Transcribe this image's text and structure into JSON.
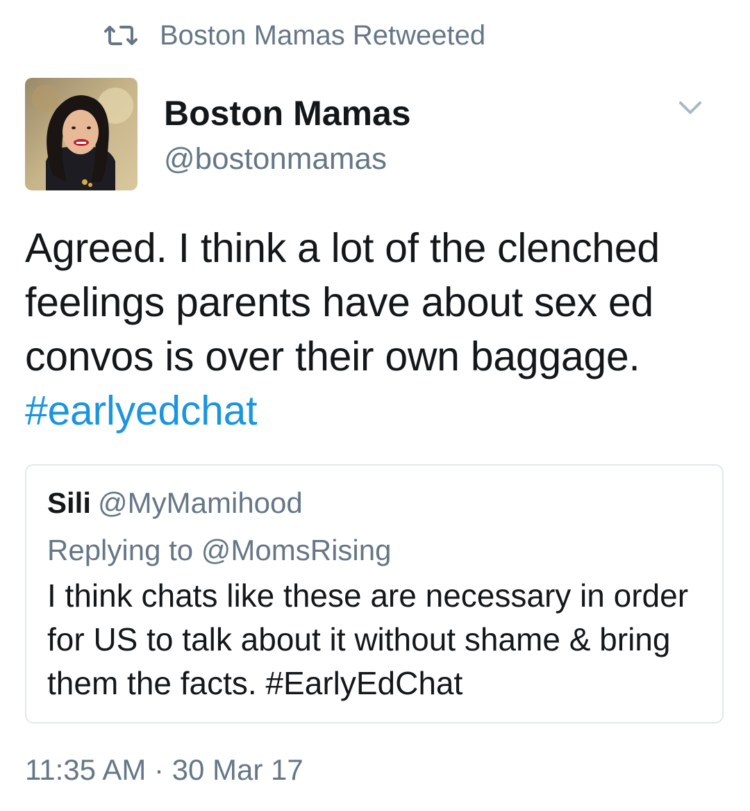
{
  "retweet_banner": {
    "icon": "retweet-icon",
    "text": "Boston Mamas Retweeted"
  },
  "author": {
    "display_name": "Boston Mamas",
    "handle": "@bostonmamas",
    "avatar": "avatar"
  },
  "menu": {
    "icon": "chevron-down-icon"
  },
  "tweet": {
    "text": "Agreed. I think a lot of the clenched feelings parents have about sex ed convos is over their own baggage.",
    "hashtag": "#earlyedchat"
  },
  "quoted_tweet": {
    "name": "Sili",
    "handle": "@MyMamihood",
    "replying_to": "Replying to @MomsRising",
    "text": "I think chats like these are necessary in order for US to talk about it without shame & bring them the facts. #EarlyEdChat"
  },
  "timestamp": "11:35 AM · 30 Mar 17",
  "colors": {
    "accent": "#1b95e0",
    "secondary_text": "#657786",
    "primary_text": "#14171a",
    "border": "#e1e8ed"
  }
}
